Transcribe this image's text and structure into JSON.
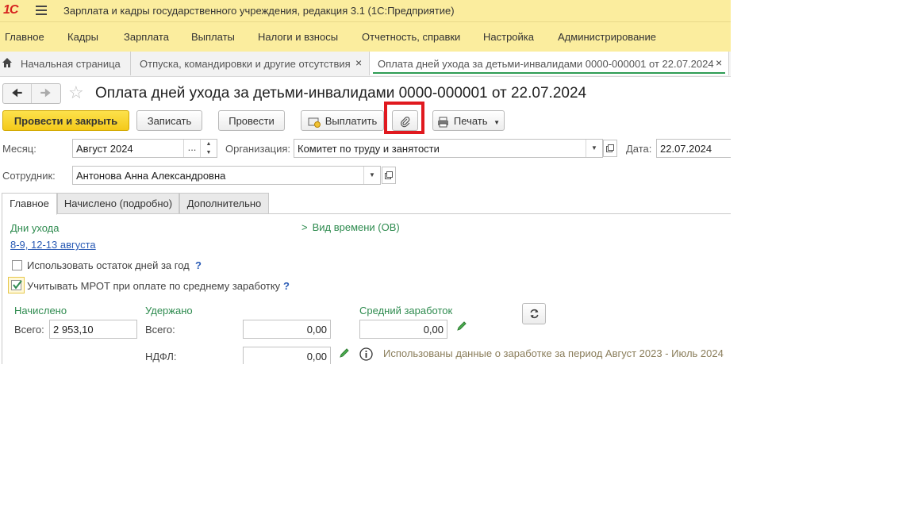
{
  "app": {
    "title": "Зарплата и кадры государственного учреждения, редакция 3.1  (1С:Предприятие)",
    "logo_text": "1С"
  },
  "menu": [
    "Главное",
    "Кадры",
    "Зарплата",
    "Выплаты",
    "Налоги и взносы",
    "Отчетность, справки",
    "Настройка",
    "Администрирование"
  ],
  "window_tabs": {
    "home": "Начальная страница",
    "tab1": "Отпуска, командировки и другие отсутствия",
    "tab2": "Оплата дней ухода за детьми-инвалидами 0000-000001 от 22.07.2024",
    "close": "×"
  },
  "document": {
    "title": "Оплата дней ухода за детьми-инвалидами 0000-000001 от 22.07.2024"
  },
  "toolbar": {
    "post_close": "Провести и закрыть",
    "save": "Записать",
    "post": "Провести",
    "pay": "Выплатить",
    "print": "Печать"
  },
  "fields": {
    "month_label": "Месяц:",
    "month_value": "Август 2024",
    "month_select": "...",
    "org_label": "Организация:",
    "org_value": "Комитет по труду и занятости",
    "date_label": "Дата:",
    "date_value": "22.07.2024",
    "employee_label": "Сотрудник:",
    "employee_value": "Антонова Анна Александровна"
  },
  "tabs": [
    "Главное",
    "Начислено (подробно)",
    "Дополнительно"
  ],
  "main": {
    "care_days_label": "Дни ухода",
    "care_days_value": "8-9, 12-13 августа",
    "time_type": "Вид времени (ОВ)",
    "use_remainder": "Использовать остаток дней за год",
    "use_remainder_checked": false,
    "mrot": "Учитывать МРОТ при оплате по среднему заработку",
    "mrot_checked": true,
    "help": "?",
    "accrued_title": "Начислено",
    "accrued_total_label": "Всего:",
    "accrued_total": "2 953,10",
    "withheld_title": "Удержано",
    "withheld_total_label": "Всего:",
    "withheld_total": "0,00",
    "ndfl_label": "НДФЛ:",
    "ndfl_value": "0,00",
    "avg_title": "Средний заработок",
    "avg_value": "0,00",
    "info_note": "Использованы данные о заработке за период Август 2023 - Июль 2024"
  },
  "colors": {
    "header_bg": "#fbed9e",
    "primary_button": "#f4c91a",
    "accent_green": "#2e8b4f",
    "highlight_red": "#e0191f",
    "link_blue": "#2a5bb5"
  }
}
